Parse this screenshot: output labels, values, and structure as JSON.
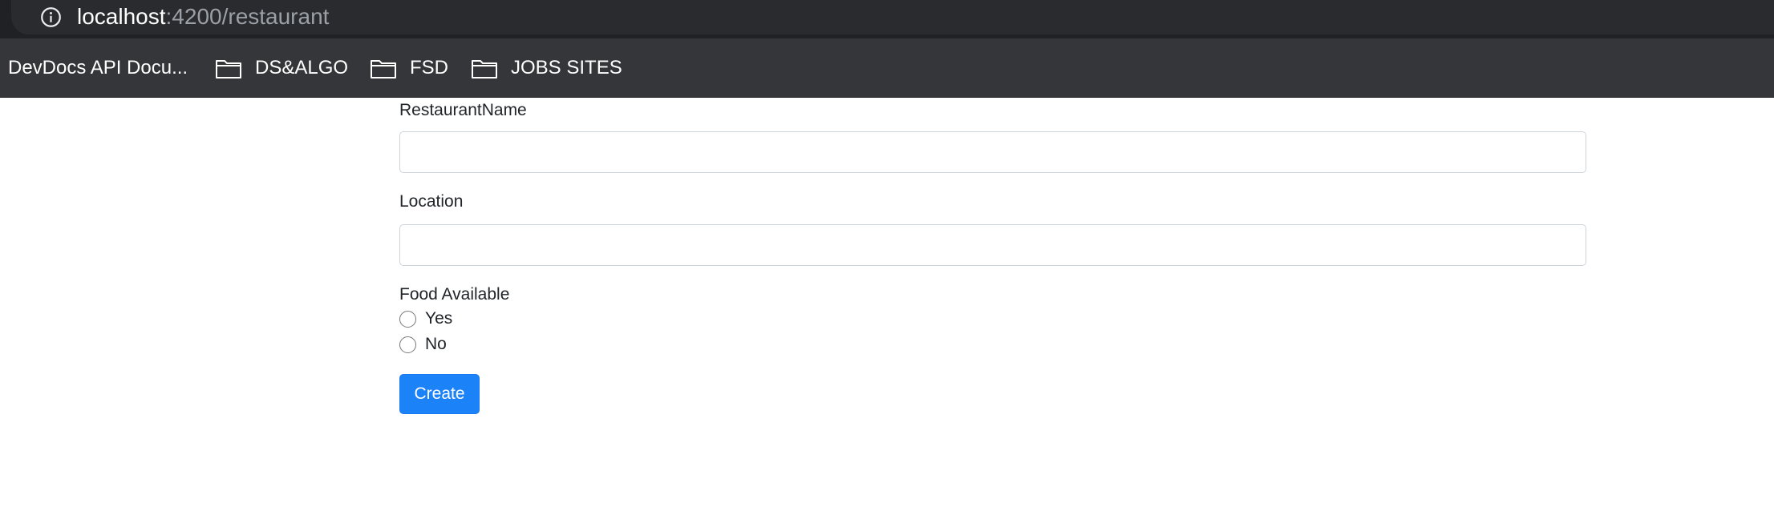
{
  "browser": {
    "url_host": "localhost",
    "url_path": ":4200/restaurant",
    "info_icon": "info-icon"
  },
  "bookmarks": {
    "items": [
      {
        "label": "DevDocs API Docu...",
        "icon": ""
      },
      {
        "label": "DS&ALGO",
        "icon": "folder-icon"
      },
      {
        "label": "FSD",
        "icon": "folder-icon"
      },
      {
        "label": "JOBS SITES",
        "icon": "folder-icon"
      }
    ]
  },
  "form": {
    "restaurant_name": {
      "label": "RestaurantName",
      "value": "",
      "placeholder": ""
    },
    "location": {
      "label": "Location",
      "value": "",
      "placeholder": ""
    },
    "food_available": {
      "label": "Food Available",
      "options": [
        {
          "label": "Yes",
          "checked": false
        },
        {
          "label": "No",
          "checked": false
        }
      ]
    },
    "submit_label": "Create"
  },
  "colors": {
    "primary_button": "#1b82f7",
    "chrome_dark": "#202124",
    "bookmark_bar": "#35363a"
  }
}
